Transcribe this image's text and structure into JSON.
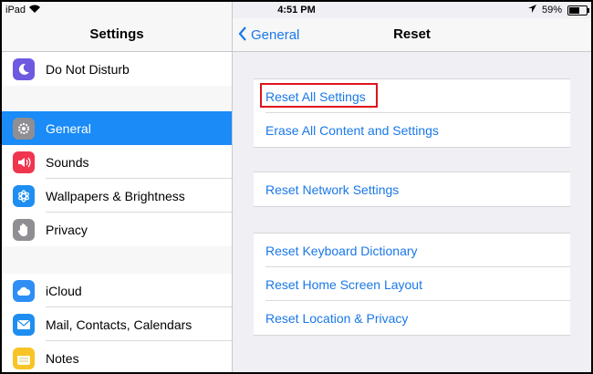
{
  "status": {
    "device": "iPad",
    "time": "4:51 PM",
    "battery": "59%",
    "battery_level": 0.59
  },
  "sidebar": {
    "title": "Settings",
    "groups": [
      {
        "items": [
          {
            "label": "Do Not Disturb",
            "icon": "moon-icon",
            "color": "#6e5ae0"
          }
        ]
      },
      {
        "items": [
          {
            "label": "General",
            "icon": "gear-icon",
            "color": "#8e8e93",
            "selected": true
          },
          {
            "label": "Sounds",
            "icon": "speaker-icon",
            "color": "#f0354f"
          },
          {
            "label": "Wallpapers & Brightness",
            "icon": "flower-icon",
            "color": "#1e8ef0"
          },
          {
            "label": "Privacy",
            "icon": "hand-icon",
            "color": "#8e8e93"
          }
        ]
      },
      {
        "items": [
          {
            "label": "iCloud",
            "icon": "cloud-icon",
            "color": "#2e8ef5"
          },
          {
            "label": "Mail, Contacts, Calendars",
            "icon": "envelope-icon",
            "color": "#1e8ef0"
          },
          {
            "label": "Notes",
            "icon": "notes-icon",
            "color": "#f6c426"
          }
        ]
      }
    ]
  },
  "main": {
    "back_label": "General",
    "title": "Reset",
    "groups": [
      {
        "items": [
          "Reset All Settings",
          "Erase All Content and Settings"
        ]
      },
      {
        "items": [
          "Reset Network Settings"
        ]
      },
      {
        "items": [
          "Reset Keyboard Dictionary",
          "Reset Home Screen Layout",
          "Reset Location & Privacy"
        ]
      }
    ]
  },
  "colors": {
    "accent": "#1a78e8",
    "selected_row": "#1a8bf7",
    "highlight_box": "#e0141c"
  }
}
